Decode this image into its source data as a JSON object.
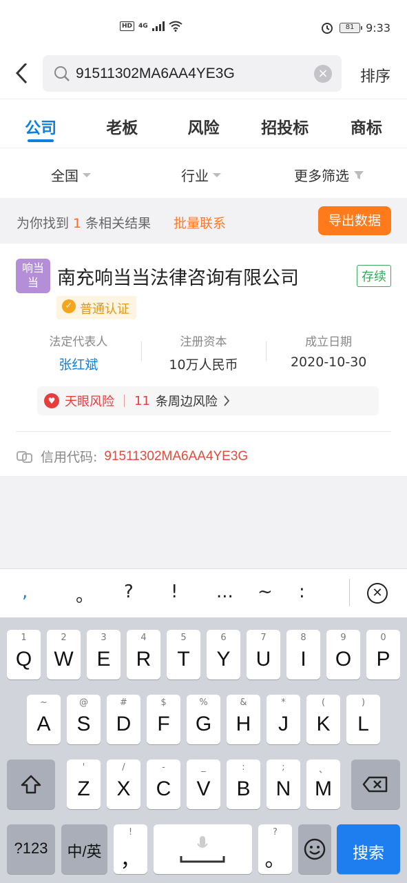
{
  "status_bar": {
    "network": "4G",
    "hd": "HD",
    "battery": "81",
    "time": "9:33"
  },
  "search": {
    "query": "91511302MA6AA4YE3G",
    "sort_label": "排序"
  },
  "tabs": [
    {
      "label": "公司",
      "active": true
    },
    {
      "label": "老板",
      "active": false
    },
    {
      "label": "风险",
      "active": false
    },
    {
      "label": "招投标",
      "active": false
    },
    {
      "label": "商标",
      "active": false
    }
  ],
  "filters": {
    "region": "全国",
    "industry": "行业",
    "more": "更多筛选"
  },
  "summary": {
    "prefix": "为你找到",
    "count": "1",
    "suffix": "条相关结果",
    "bulk_contact": "批量联系",
    "export": "导出数据"
  },
  "result": {
    "logo_text": "响当当",
    "name": "南充响当当法律咨询有限公司",
    "status": "存续",
    "cert": "普通认证",
    "legal_rep_label": "法定代表人",
    "legal_rep": "张红斌",
    "capital_label": "注册资本",
    "capital": "10万人民币",
    "founded_label": "成立日期",
    "founded": "2020-10-30",
    "risk_title": "天眼风险",
    "risk_count": "11",
    "risk_desc": "条周边风险",
    "credit_label": "信用代码:",
    "credit_code": "91511302MA6AA4YE3G"
  },
  "keyboard": {
    "quick": [
      ",",
      "。",
      "?",
      "!",
      "...",
      "~",
      ":"
    ],
    "row1": [
      {
        "k": "Q",
        "h": "1"
      },
      {
        "k": "W",
        "h": "2"
      },
      {
        "k": "E",
        "h": "3"
      },
      {
        "k": "R",
        "h": "4"
      },
      {
        "k": "T",
        "h": "5"
      },
      {
        "k": "Y",
        "h": "6"
      },
      {
        "k": "U",
        "h": "7"
      },
      {
        "k": "I",
        "h": "8"
      },
      {
        "k": "O",
        "h": "9"
      },
      {
        "k": "P",
        "h": "0"
      }
    ],
    "row2": [
      {
        "k": "A",
        "h": "~"
      },
      {
        "k": "S",
        "h": "@"
      },
      {
        "k": "D",
        "h": "#"
      },
      {
        "k": "F",
        "h": "$"
      },
      {
        "k": "G",
        "h": "%"
      },
      {
        "k": "H",
        "h": "&"
      },
      {
        "k": "J",
        "h": "*"
      },
      {
        "k": "K",
        "h": "("
      },
      {
        "k": "L",
        "h": ")"
      }
    ],
    "row3": [
      {
        "k": "Z",
        "h": "'"
      },
      {
        "k": "X",
        "h": "/"
      },
      {
        "k": "C",
        "h": "-"
      },
      {
        "k": "V",
        "h": "_"
      },
      {
        "k": "B",
        "h": ":"
      },
      {
        "k": "N",
        "h": ";"
      },
      {
        "k": "M",
        "h": "、"
      }
    ],
    "num_key": "?123",
    "lang_key": "中/英",
    "comma_key": "，",
    "comma_hint": "!",
    "period_key": "。",
    "period_hint": "?",
    "search_key": "搜索"
  }
}
